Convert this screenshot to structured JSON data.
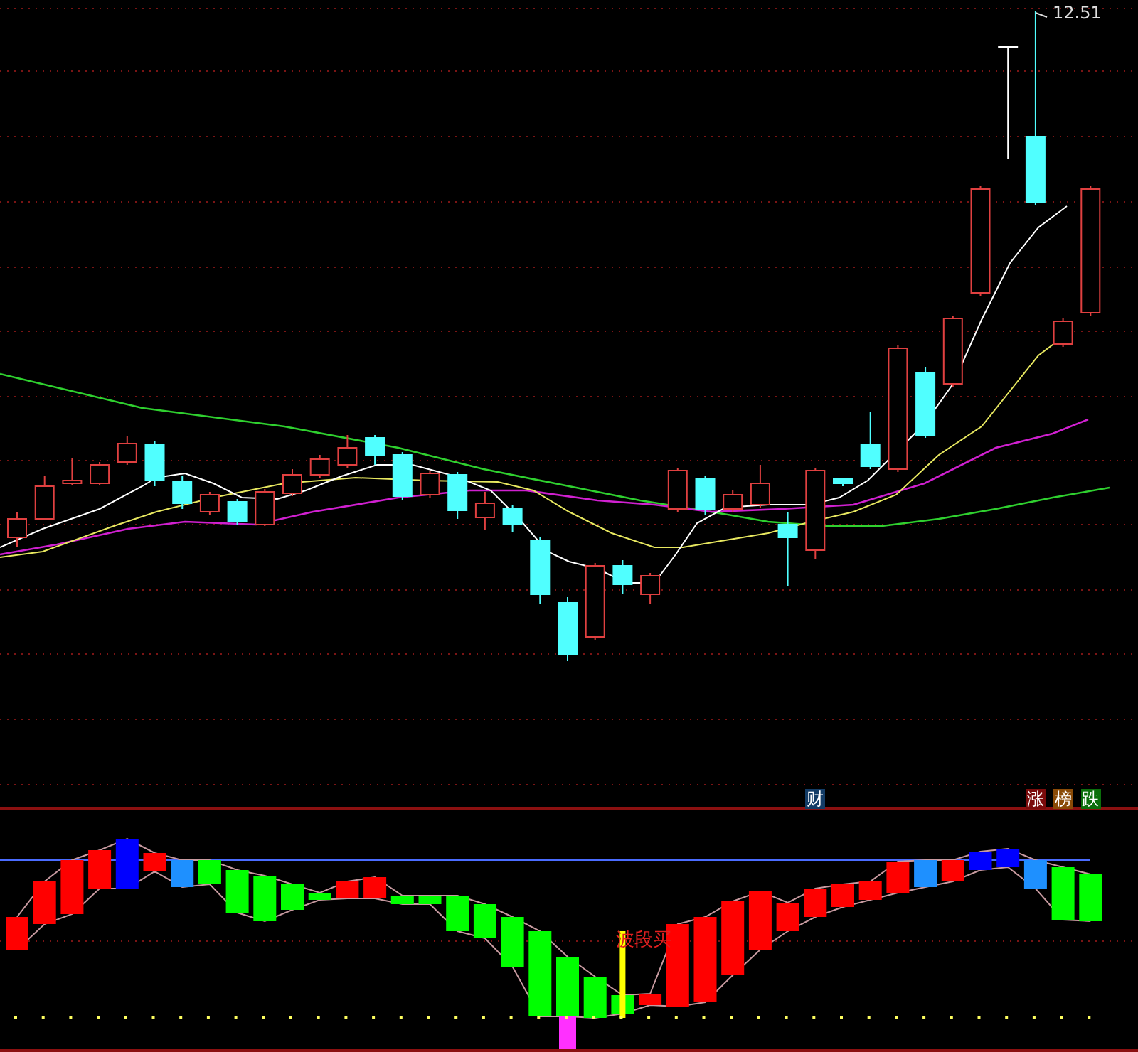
{
  "price_chart": {
    "high_label": "12.51"
  },
  "news_tags": [
    {
      "label": "财",
      "color": "#133c66"
    },
    {
      "label": "涨",
      "color": "#7a0b0b"
    },
    {
      "label": "榜",
      "color": "#8a4a06"
    },
    {
      "label": "跌",
      "color": "#0b6e0b"
    }
  ],
  "indicator": {
    "signal_label": "波段买"
  }
}
